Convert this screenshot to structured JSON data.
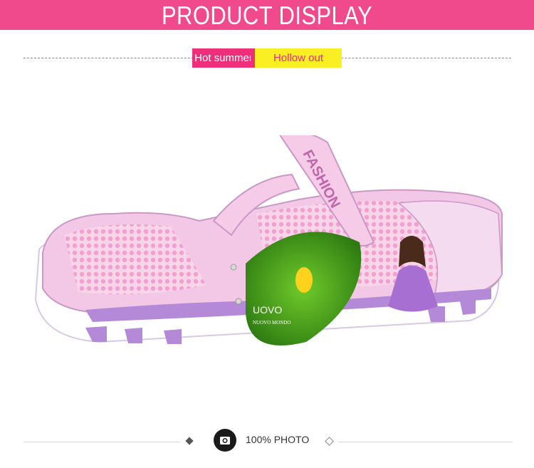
{
  "header": {
    "title": "PRODUCT DISPLAY"
  },
  "tags": {
    "primary": "Hot summer",
    "secondary": "Hollow out"
  },
  "product": {
    "strap_text": "FASHION",
    "hangtag_brand": "UOVO",
    "hangtag_sub": "NUOVO MONDO",
    "colors": {
      "upper": "#f2c8e6",
      "mesh": "#f7b5de",
      "sole": "#b48ad8",
      "accent": "#ef2f7a"
    }
  },
  "footer": {
    "label": "100% PHOTO",
    "icon": "camera-icon"
  }
}
